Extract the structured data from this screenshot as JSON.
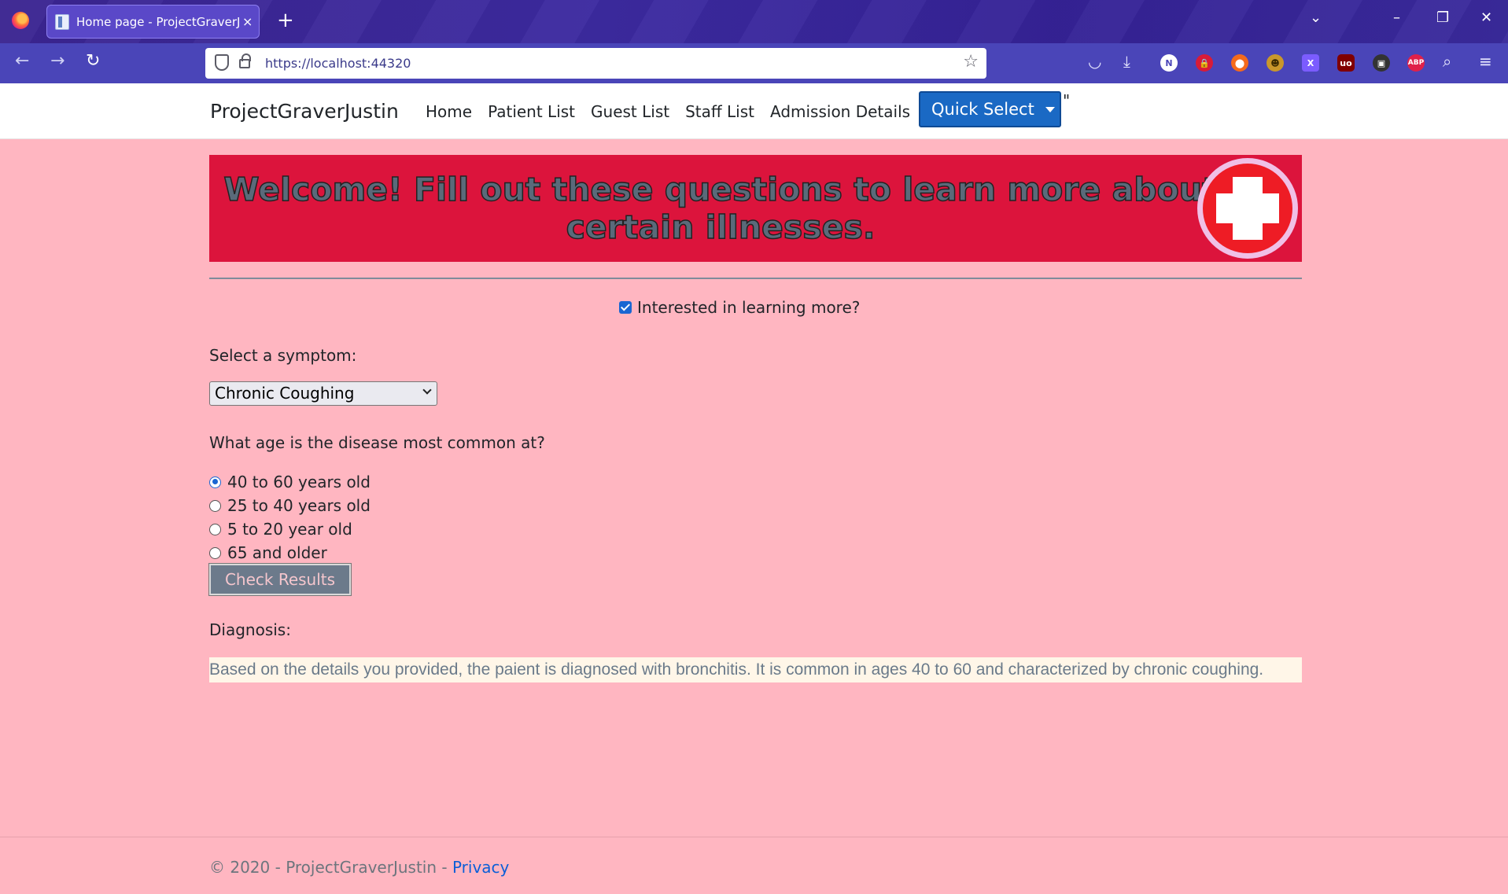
{
  "browser": {
    "tab_title": "Home page - ProjectGraverJustin",
    "tab_close": "×",
    "new_tab": "+",
    "url": "https://localhost:44320",
    "window_controls": [
      "⌄",
      "–",
      "❐",
      "✕"
    ],
    "nav_icons": [
      "back-icon",
      "forward-icon",
      "reload-icon"
    ],
    "extensions": [
      {
        "label": "N",
        "color": "#ffffff",
        "text_color": "#4a45b8"
      },
      {
        "label": "🔒",
        "color": "#d81b38",
        "text_color": "#ffffff"
      },
      {
        "label": "⬤",
        "color": "#f56a1b",
        "text_color": "#ffffff"
      },
      {
        "label": "☻",
        "color": "#c9972b",
        "text_color": "#3a2a00"
      },
      {
        "label": "X",
        "color": "#7b5cff",
        "text_color": "#ffffff"
      },
      {
        "label": "uo",
        "color": "#800000",
        "text_color": "#ffffff"
      },
      {
        "label": "▣",
        "color": "#333333",
        "text_color": "#ffffff"
      },
      {
        "label": "ABP",
        "color": "#e0204a",
        "text_color": "#ffffff"
      }
    ]
  },
  "site": {
    "brand": "ProjectGraverJustin",
    "nav": [
      "Home",
      "Patient List",
      "Guest List",
      "Staff List",
      "Admission Details"
    ],
    "quick_select": "Quick Select",
    "stray_mark": "\""
  },
  "banner": {
    "text": "Welcome! Fill out these questions to learn more about certain illnesses.",
    "background": "#dc143c"
  },
  "form": {
    "interest_label": "Interested in learning more?",
    "interest_checked": true,
    "symptom_label": "Select a symptom:",
    "symptom_value": "Chronic Coughing",
    "age_question": "What age is the disease most common at?",
    "age_options": [
      "40 to 60 years old",
      "25 to 40 years old",
      "5 to 20 year old",
      "65 and older"
    ],
    "age_selected_index": 0,
    "submit_label": "Check Results",
    "diagnosis_label": "Diagnosis:",
    "diagnosis_text": "Based on the details you provided, the paient is diagnosed with bronchitis. It is common in ages 40 to 60 and characterized by chronic coughing."
  },
  "footer": {
    "copyright": "© 2020 - ProjectGraverJustin - ",
    "privacy": "Privacy"
  },
  "colors": {
    "page_background": "#ffb6c1",
    "primary": "#1a69c4"
  }
}
